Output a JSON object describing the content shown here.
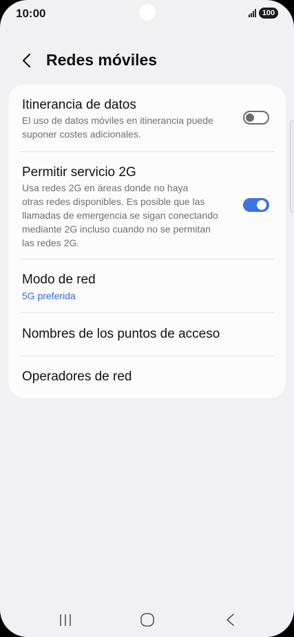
{
  "status_bar": {
    "time": "10:00",
    "battery": "100"
  },
  "header": {
    "title": "Redes móviles"
  },
  "settings": {
    "roaming": {
      "title": "Itinerancia de datos",
      "lines": [
        "El uso de datos móviles en itinerancia puede",
        "suponer costes adicionales."
      ],
      "enabled": false
    },
    "allow_2g": {
      "title": "Permitir servicio 2G",
      "lines": [
        "Usa redes 2G en áreas donde no haya",
        "otras redes disponibles. Es posible que las",
        "llamadas de emergencia se sigan conectando",
        "mediante 2G incluso cuando no se permitan",
        "las redes 2G."
      ],
      "enabled": true
    },
    "network_mode": {
      "title": "Modo de red",
      "value": "5G preferida"
    },
    "apn": {
      "title": "Nombres de los puntos de acceso"
    },
    "operators": {
      "title": "Operadores de red"
    }
  },
  "colors": {
    "accent": "#3a74e0",
    "background": "#f1f1f3",
    "card": "#fcfcfd",
    "value_text": "#2f6ad0"
  },
  "icons": [
    "back-icon",
    "recent-apps-icon",
    "home-icon",
    "nav-back-icon"
  ]
}
